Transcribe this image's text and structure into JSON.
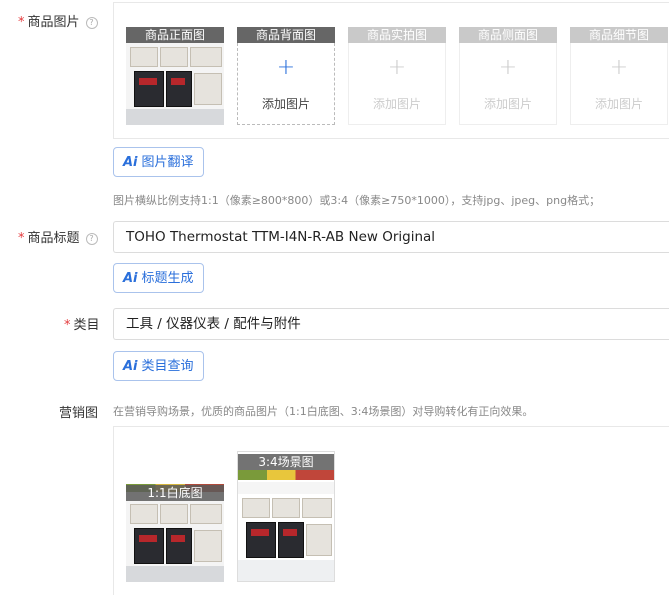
{
  "product_images": {
    "label": "商品图片",
    "required": "*",
    "help": "?",
    "slots": [
      {
        "title": "商品正面图",
        "state": "filled"
      },
      {
        "title": "商品背面图",
        "state": "add",
        "add_text": "添加图片"
      },
      {
        "title": "商品实拍图",
        "state": "disabled",
        "add_text": "添加图片"
      },
      {
        "title": "商品侧面图",
        "state": "disabled",
        "add_text": "添加图片"
      },
      {
        "title": "商品细节图",
        "state": "disabled",
        "add_text": "添加图片"
      }
    ],
    "ai_button": {
      "icon": "Ai",
      "label": "图片翻译"
    },
    "hint": "图片横纵比例支持1:1（像素≥800*800）或3:4（像素≥750*1000），支持jpg、jpeg、png格式；"
  },
  "product_title": {
    "label": "商品标题",
    "required": "*",
    "help": "?",
    "value": "TOHO Thermostat TTM-I4N-R-AB New Original",
    "ai_button": {
      "icon": "Ai",
      "label": "标题生成"
    }
  },
  "category": {
    "label": "类目",
    "required": "*",
    "value": "工具 / 仪器仪表 / 配件与附件",
    "ai_button": {
      "icon": "Ai",
      "label": "类目查询"
    }
  },
  "marketing": {
    "label": "营销图",
    "hint": "在营销导购场景，优质的商品图片（1:1白底图、3:4场景图）对导购转化有正向效果。",
    "images": [
      {
        "label": "1:1白底图"
      },
      {
        "label": "3:4场景图"
      }
    ]
  },
  "colors": {
    "accent": "#2a6fdb",
    "required": "#e4393c",
    "hint": "#888888"
  }
}
